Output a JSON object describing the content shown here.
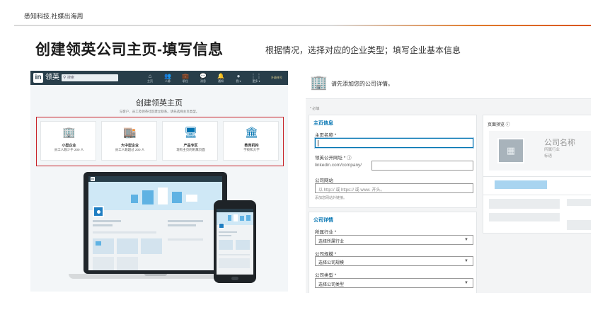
{
  "brand": "悉知科技.社媒出海周",
  "slide": {
    "title": "创建领英公司主页-填写信息",
    "subtitle": "根据情况，选择对应的企业类型；填写企业基本信息"
  },
  "left": {
    "topbar": {
      "logo": "in",
      "brand_cn": "领英",
      "search_placeholder": "搜索",
      "nav": [
        {
          "icon": "⌂",
          "label": "主页"
        },
        {
          "icon": "👥",
          "label": "人脉"
        },
        {
          "icon": "💼",
          "label": "职位"
        },
        {
          "icon": "💬",
          "label": "消息"
        },
        {
          "icon": "🔔",
          "label": "通知"
        },
        {
          "icon": "●",
          "label": "我 ▾"
        },
        {
          "icon": "⋮⋮",
          "label": "更多 ▾"
        }
      ],
      "upgrade": "升级帐号"
    },
    "heading": "创建领英主页",
    "subheading": "与客户、员工及领英社区建立联系。请先选择主页类型。",
    "types": [
      {
        "icon": "🏢",
        "title": "小型企业",
        "desc": "员工人数少于 200 人"
      },
      {
        "icon": "🏬",
        "title": "大中型企业",
        "desc": "员工人数超过 200 人"
      },
      {
        "icon": "🖥",
        "title": "产品专区",
        "desc": "现有主页的附属页面"
      },
      {
        "icon": "🏛",
        "title": "教育机构",
        "desc": "学校和大学"
      }
    ],
    "device_logo": "in"
  },
  "right": {
    "header_text": "请先添加您的公司详情。",
    "required_note": "* 必填",
    "main_info": {
      "title": "主页信息",
      "name_label": "主页名称 *",
      "url_label": "领英公开网址 * ⓘ",
      "url_prefix": "linkedin.com/company/",
      "website_label": "公司网站",
      "website_placeholder": "以 http:// 或 https:// 或 www. 开头。",
      "website_help": "添加您网站外链接。"
    },
    "company_detail": {
      "title": "公司详情",
      "industry_label": "所属行业 *",
      "industry_value": "选择所属行业",
      "size_label": "公司规模 *",
      "size_value": "选择公司规模",
      "type_label": "公司类型 *",
      "type_value": "选择公司类型",
      "arrow": "▼"
    },
    "preview": {
      "title": "页面预览 ⓘ",
      "company_name": "公司名称",
      "industry": "所属行业",
      "tagline": "标语"
    }
  }
}
